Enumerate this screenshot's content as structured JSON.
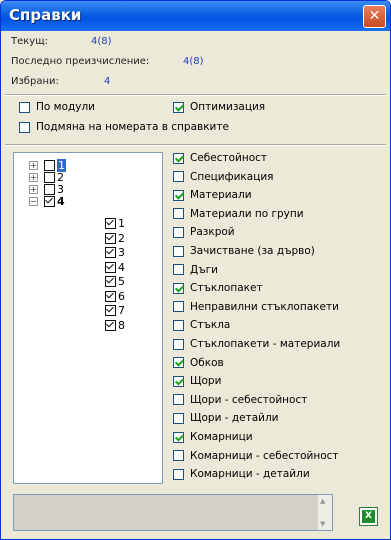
{
  "window": {
    "title": "Справки",
    "close_glyph": "✕"
  },
  "info": {
    "current_label": "Текущ:",
    "current_value": "4(8)",
    "last_calc_label": "Последно преизчисление:",
    "last_calc_value": "4(8)",
    "selected_label": "Избрани:",
    "selected_value": "4"
  },
  "options": [
    {
      "label": "По модули",
      "checked": false
    },
    {
      "label": "Оптимизация",
      "checked": true
    },
    {
      "label": "Подмяна на номерата в справките",
      "checked": false
    }
  ],
  "tree": {
    "roots": [
      {
        "label": "1",
        "checked": false,
        "expanded": false,
        "selected": true,
        "expander": "+"
      },
      {
        "label": "2",
        "checked": false,
        "expanded": false,
        "expander": "+"
      },
      {
        "label": "3",
        "checked": false,
        "expanded": false,
        "expander": "+"
      },
      {
        "label": "4",
        "checked": true,
        "expanded": true,
        "expander": "−"
      }
    ],
    "children": [
      {
        "label": "1",
        "checked": true
      },
      {
        "label": "2",
        "checked": true
      },
      {
        "label": "3",
        "checked": true
      },
      {
        "label": "4",
        "checked": true
      },
      {
        "label": "5",
        "checked": true
      },
      {
        "label": "6",
        "checked": true
      },
      {
        "label": "7",
        "checked": true
      },
      {
        "label": "8",
        "checked": true
      }
    ]
  },
  "reports": [
    {
      "label": "Себестойност",
      "checked": true
    },
    {
      "label": "Спецификация",
      "checked": false
    },
    {
      "label": "Материали",
      "checked": true
    },
    {
      "label": "Материали по групи",
      "checked": false
    },
    {
      "label": "Разкрой",
      "checked": false
    },
    {
      "label": "Зачистване (за дърво)",
      "checked": false
    },
    {
      "label": "Дъги",
      "checked": false
    },
    {
      "label": "Стъклопакет",
      "checked": true
    },
    {
      "label": "Неправилни стъклопакети",
      "checked": false
    },
    {
      "label": "Стъкла",
      "checked": false
    },
    {
      "label": "Стъклопакети - материали",
      "checked": false
    },
    {
      "label": "Обков",
      "checked": true
    },
    {
      "label": "Щори",
      "checked": true
    },
    {
      "label": "Щори - себестойност",
      "checked": false
    },
    {
      "label": "Щори - детайли",
      "checked": false
    },
    {
      "label": "Комарници",
      "checked": true
    },
    {
      "label": "Комарници - себестойност",
      "checked": false
    },
    {
      "label": "Комарници - детайли",
      "checked": false
    }
  ],
  "memo": {
    "up_arrow": "▲",
    "down_arrow": "▼"
  },
  "excel_button": {
    "icon": "excel-icon",
    "glyph": "X"
  }
}
